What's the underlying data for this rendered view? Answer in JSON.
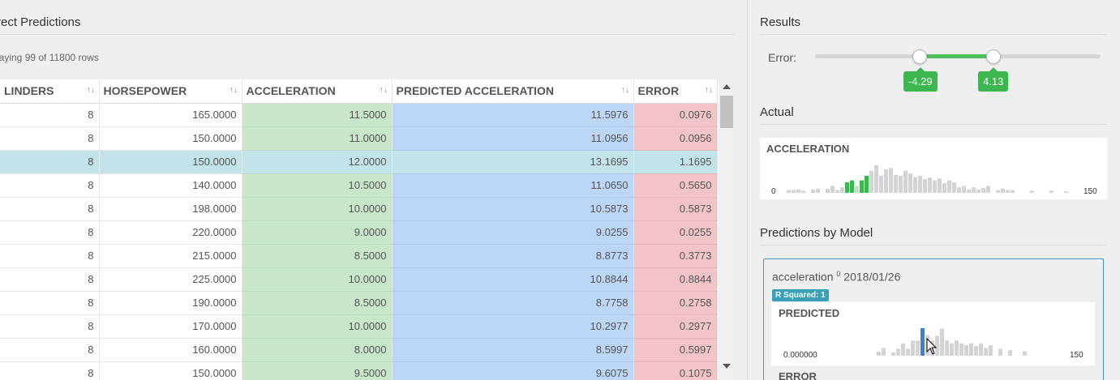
{
  "left": {
    "title": "rect Predictions",
    "row_count": "laying 99 of 11800 rows",
    "columns": [
      "LINDERS",
      "HORSEPOWER",
      "ACCELERATION",
      "PREDICTED ACCELERATION",
      "ERROR"
    ],
    "sort_icon": "↑↓",
    "rows": [
      [
        "8",
        "165.0000",
        "11.5000",
        "11.5976",
        "0.0976"
      ],
      [
        "8",
        "150.0000",
        "11.0000",
        "11.0956",
        "0.0956"
      ],
      [
        "8",
        "150.0000",
        "12.0000",
        "13.1695",
        "1.1695"
      ],
      [
        "8",
        "140.0000",
        "10.5000",
        "11.0650",
        "0.5650"
      ],
      [
        "8",
        "198.0000",
        "10.0000",
        "10.5873",
        "0.5873"
      ],
      [
        "8",
        "220.0000",
        "9.0000",
        "9.0255",
        "0.0255"
      ],
      [
        "8",
        "215.0000",
        "8.5000",
        "8.8773",
        "0.3773"
      ],
      [
        "8",
        "225.0000",
        "10.0000",
        "10.8844",
        "0.8844"
      ],
      [
        "8",
        "190.0000",
        "8.5000",
        "8.7758",
        "0.2758"
      ],
      [
        "8",
        "170.0000",
        "10.0000",
        "10.2977",
        "0.2977"
      ],
      [
        "8",
        "160.0000",
        "8.0000",
        "8.5997",
        "0.5997"
      ],
      [
        "8",
        "150.0000",
        "9.5000",
        "9.6075",
        "0.1075"
      ]
    ],
    "selected_row_index": 2
  },
  "results": {
    "title": "Results",
    "error_label": "Error:",
    "low": "-4.29",
    "high": "4.13"
  },
  "actual": {
    "title": "Actual",
    "label": "ACCELERATION",
    "min": "0",
    "max": "150",
    "bins": [
      0.1,
      0.1,
      0.12,
      0.08,
      0,
      0.12,
      0.15,
      0,
      0.15,
      0.25,
      0.1,
      0.2,
      0.38,
      0.45,
      0.25,
      0.45,
      0.62,
      0.8,
      1.0,
      0.62,
      0.85,
      0.9,
      0.65,
      0.62,
      0.8,
      0.7,
      0.58,
      0.62,
      0.5,
      0.55,
      0.45,
      0.52,
      0.35,
      0.45,
      0.38,
      0.2,
      0.25,
      0.12,
      0.2,
      0.12,
      0.18,
      0.25,
      0,
      0.1,
      0.15,
      0.1,
      0.1,
      0,
      0,
      0,
      0.08,
      0,
      0,
      0,
      0.08,
      0,
      0,
      0.05
    ],
    "highlight_bins": [
      12,
      13,
      15,
      16
    ]
  },
  "predictions": {
    "title": "Predictions by Model",
    "model_name": "acceleration",
    "model_version": "0",
    "model_date": "2018/01/26",
    "badge": "R Squared: 1",
    "predicted_label": "PREDICTED",
    "pred_min": "0.000000",
    "pred_max": "150",
    "pred_bins": [
      0.15,
      0.28,
      0,
      0.12,
      0.25,
      0.45,
      0.25,
      0.55,
      0.55,
      1.0,
      0.75,
      0.55,
      0.72,
      0.98,
      0.55,
      0.45,
      0.55,
      0.45,
      0.38,
      0.45,
      0.35,
      0.45,
      0.28,
      0.38,
      0,
      0.25,
      0,
      0.2,
      0,
      0,
      0.15
    ],
    "pred_highlight_bin": 9,
    "error_label": "ERROR"
  }
}
